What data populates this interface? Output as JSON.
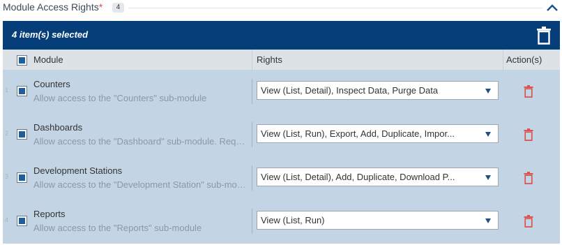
{
  "section": {
    "title": "Module Access Rights",
    "required_mark": "*",
    "count": "4"
  },
  "selection_bar": {
    "text": "4 item(s) selected"
  },
  "table": {
    "headers": {
      "module": "Module",
      "rights": "Rights",
      "actions": "Action(s)"
    },
    "rows": [
      {
        "num": "1",
        "name": "Counters",
        "description": "Allow access to the \"Counters\" sub-module",
        "rights": "View (List, Detail), Inspect Data, Purge Data"
      },
      {
        "num": "2",
        "name": "Dashboards",
        "description": "Allow access to the \"Dashboard\" sub-module. Requi...",
        "rights": "View (List, Run), Export, Add, Duplicate, Impor..."
      },
      {
        "num": "3",
        "name": "Development Stations",
        "description": "Allow access to the \"Development Station\" sub-mod...",
        "rights": "View (List, Detail), Add, Duplicate, Download P..."
      },
      {
        "num": "4",
        "name": "Reports",
        "description": "Allow access to the \"Reports\" sub-module",
        "rights": "View (List, Run)"
      }
    ]
  },
  "colors": {
    "selection_bar": "#063e7a",
    "row_background": "#c3d4e5",
    "header_background": "#dde2e7",
    "checkbox_fill": "#1f5e9e",
    "delete_icon": "#d9534f",
    "required": "#d9534f"
  },
  "icons": {
    "collapse": "chevron-up-icon",
    "bulk_delete": "trash-icon",
    "row_delete": "trash-icon",
    "dropdown": "caret-down-icon"
  }
}
